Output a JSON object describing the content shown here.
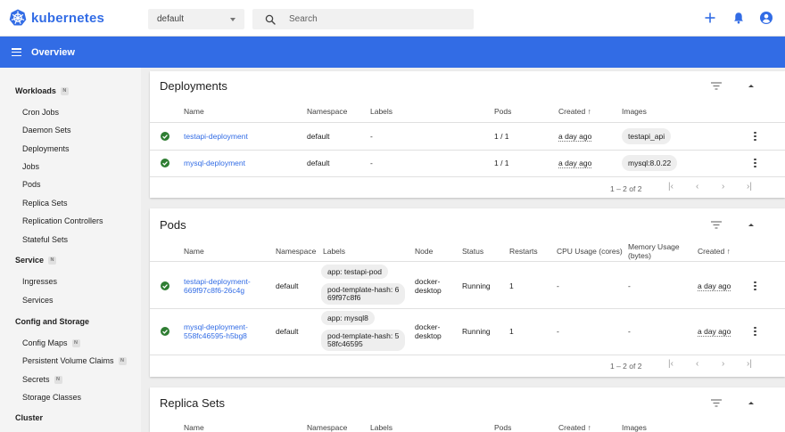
{
  "app": {
    "logo_text": "kubernetes"
  },
  "header": {
    "namespace": "default",
    "search_placeholder": "Search",
    "accent": "#326ce5"
  },
  "navbar": {
    "title": "Overview"
  },
  "sidebar": {
    "workloads": {
      "label": "Workloads",
      "badge": "N"
    },
    "workload_items": [
      "Cron Jobs",
      "Daemon Sets",
      "Deployments",
      "Jobs",
      "Pods",
      "Replica Sets",
      "Replication Controllers",
      "Stateful Sets"
    ],
    "service": {
      "label": "Service",
      "badge": "N"
    },
    "service_items": [
      "Ingresses",
      "Services"
    ],
    "config": {
      "label": "Config and Storage"
    },
    "config_items": [
      {
        "label": "Config Maps",
        "badge": "N"
      },
      {
        "label": "Persistent Volume Claims",
        "badge": "N"
      },
      {
        "label": "Secrets",
        "badge": "N"
      },
      {
        "label": "Storage Classes",
        "badge": ""
      }
    ],
    "cluster": {
      "label": "Cluster"
    }
  },
  "deployments": {
    "title": "Deployments",
    "columns": {
      "name": "Name",
      "namespace": "Namespace",
      "labels": "Labels",
      "pods": "Pods",
      "created": "Created ↑",
      "images": "Images"
    },
    "rows": [
      {
        "name": "testapi-deployment",
        "namespace": "default",
        "labels": "-",
        "pods": "1 / 1",
        "created": "a day ago",
        "image": "testapi_api"
      },
      {
        "name": "mysql-deployment",
        "namespace": "default",
        "labels": "-",
        "pods": "1 / 1",
        "created": "a day ago",
        "image": "mysql:8.0.22"
      }
    ],
    "pager": "1 – 2 of 2"
  },
  "pods": {
    "title": "Pods",
    "columns": {
      "name": "Name",
      "namespace": "Namespace",
      "labels": "Labels",
      "node": "Node",
      "status": "Status",
      "restarts": "Restarts",
      "cpu": "CPU Usage (cores)",
      "memory_1": "Memory Usage",
      "memory_2": "(bytes)",
      "created": "Created ↑"
    },
    "rows": [
      {
        "name_1": "testapi-deployment-",
        "name_2": "669f97c8f6-26c4g",
        "namespace": "default",
        "label_app": "app: testapi-pod",
        "label_hash_1": "pod-template-hash: 6",
        "label_hash_2": "69f97c8f6",
        "node_1": "docker-",
        "node_2": "desktop",
        "status": "Running",
        "restarts": "1",
        "cpu": "-",
        "memory": "-",
        "created": "a day ago"
      },
      {
        "name_1": "mysql-deployment-",
        "name_2": "558fc46595-h5bg8",
        "namespace": "default",
        "label_app": "app: mysql8",
        "label_hash_1": "pod-template-hash: 5",
        "label_hash_2": "58fc46595",
        "node_1": "docker-",
        "node_2": "desktop",
        "status": "Running",
        "restarts": "1",
        "cpu": "-",
        "memory": "-",
        "created": "a day ago"
      }
    ],
    "pager": "1 – 2 of 2"
  },
  "replica_sets": {
    "title": "Replica Sets",
    "columns": {
      "name": "Name",
      "namespace": "Namespace",
      "labels": "Labels",
      "pods": "Pods",
      "created": "Created ↑",
      "images": "Images"
    }
  },
  "colors": {
    "success": "#2e7d32",
    "link": "#326ce5"
  }
}
